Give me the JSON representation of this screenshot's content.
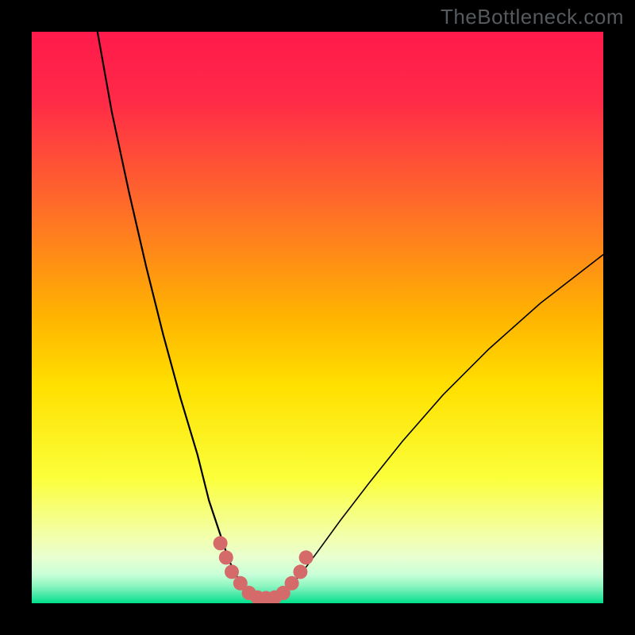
{
  "watermark": "TheBottleneck.com",
  "chart_data": {
    "type": "line",
    "title": "",
    "xlabel": "",
    "ylabel": "",
    "xlim": [
      0,
      100
    ],
    "ylim": [
      0,
      100
    ],
    "background_gradient": {
      "top": "#ff1a4b",
      "upper_mid": "#ff6a2a",
      "mid": "#ffd400",
      "lower_mid": "#f7ff6a",
      "near_bottom": "#b8ffb8",
      "bottom": "#00e08a"
    },
    "series": [
      {
        "name": "left-branch",
        "x": [
          11.5,
          14,
          17,
          20,
          23,
          26,
          29,
          31,
          33,
          34.5,
          36,
          37.5
        ],
        "y": [
          100,
          86,
          72,
          59,
          47,
          36,
          26,
          18,
          12,
          7.5,
          4.5,
          2
        ],
        "stroke": "#000000",
        "width": 2.2
      },
      {
        "name": "valley-floor",
        "x": [
          37.5,
          39,
          41,
          43,
          44.5
        ],
        "y": [
          2,
          1.1,
          0.9,
          1.1,
          2
        ],
        "stroke": "#000000",
        "width": 2.2
      },
      {
        "name": "right-branch",
        "x": [
          44.5,
          47,
          50,
          54,
          59,
          65,
          72,
          80,
          89,
          100
        ],
        "y": [
          2,
          5,
          9,
          14.5,
          21,
          28.5,
          36.5,
          44.5,
          52.5,
          61
        ],
        "stroke": "#000000",
        "width": 1.6
      },
      {
        "name": "marker-dots",
        "type": "scatter",
        "color": "#d56a6a",
        "points": [
          {
            "x": 33.0,
            "y": 10.5
          },
          {
            "x": 34.0,
            "y": 8.0
          },
          {
            "x": 35.0,
            "y": 5.5
          },
          {
            "x": 36.5,
            "y": 3.5
          },
          {
            "x": 38.0,
            "y": 1.8
          },
          {
            "x": 39.5,
            "y": 1.0
          },
          {
            "x": 41.0,
            "y": 0.9
          },
          {
            "x": 42.5,
            "y": 1.0
          },
          {
            "x": 44.0,
            "y": 1.8
          },
          {
            "x": 45.5,
            "y": 3.5
          },
          {
            "x": 47.0,
            "y": 5.5
          },
          {
            "x": 48.0,
            "y": 8.0
          }
        ]
      }
    ]
  }
}
